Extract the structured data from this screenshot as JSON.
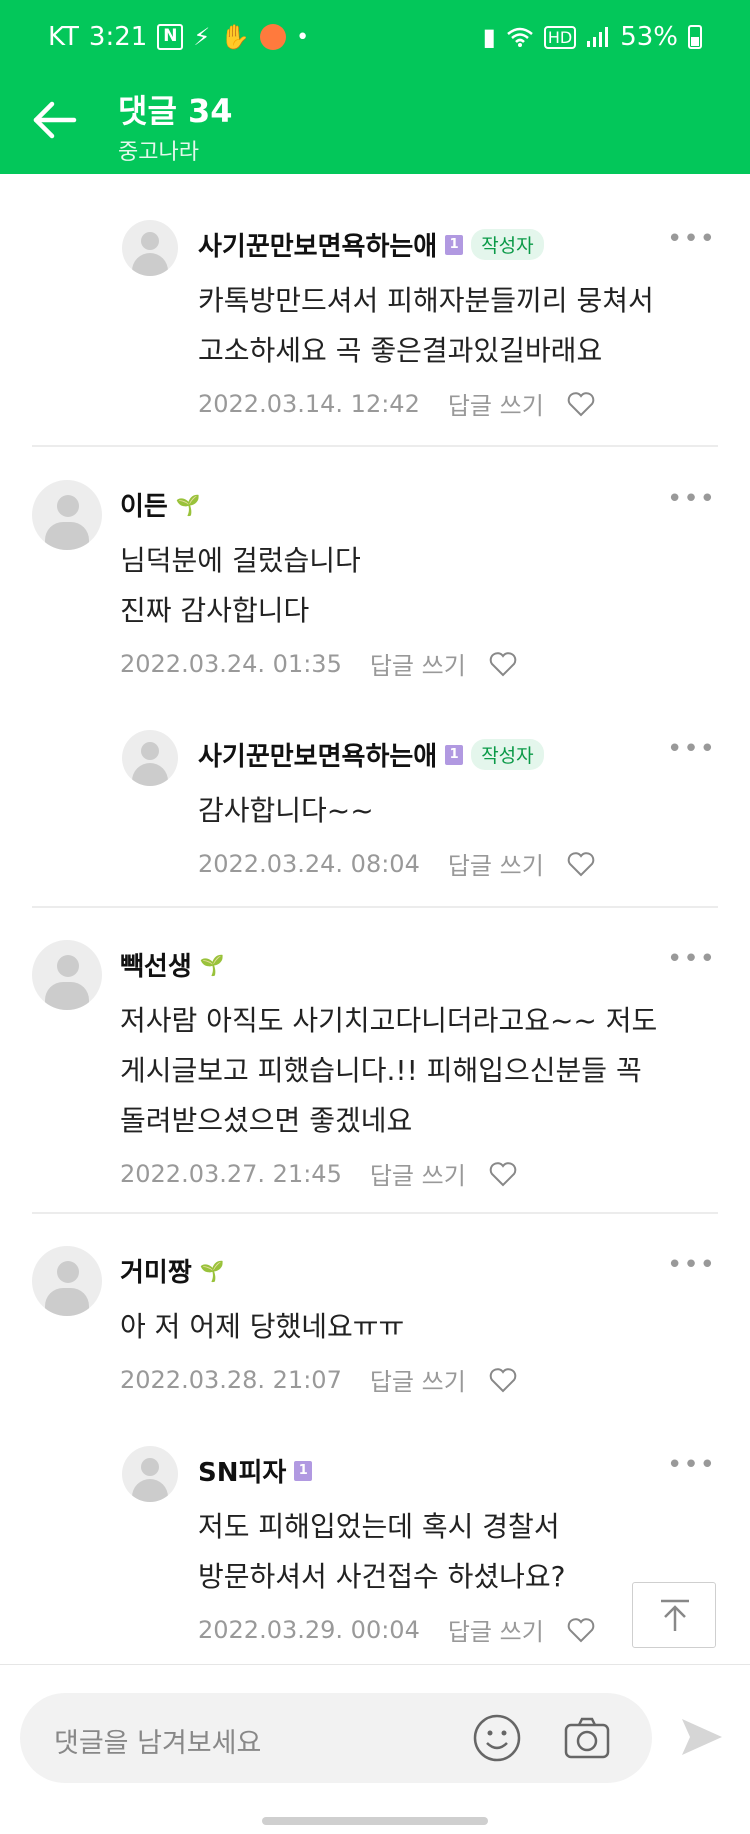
{
  "status": {
    "carrier": "KT",
    "time": "3:21",
    "n_badge": "N",
    "net": "HD",
    "battery": "53%"
  },
  "header": {
    "title": "댓글 34",
    "subtitle": "중고나라"
  },
  "comments": [
    {
      "nick": "사기꾼만보면욕하는애",
      "level": "1",
      "author_badge": "작성자",
      "body": [
        "카톡방만드셔서 피해자분들끼리 뭉쳐서",
        "고소하세요 곡 좋은결과있길바래요"
      ],
      "date": "2022.03.14. 12:42",
      "reply": "답글 쓰기"
    },
    {
      "nick": "이든",
      "body": [
        "님덕분에 걸렀습니다",
        "진짜 감사합니다"
      ],
      "date": "2022.03.24. 01:35",
      "reply": "답글 쓰기"
    },
    {
      "nick": "사기꾼만보면욕하는애",
      "level": "1",
      "author_badge": "작성자",
      "body": [
        "감사합니다~~"
      ],
      "date": "2022.03.24. 08:04",
      "reply": "답글 쓰기"
    },
    {
      "nick": "빽선생",
      "body": [
        "저사람 아직도 사기치고다니더라고요~~ 저도",
        "게시글보고 피했습니다.!! 피해입으신분들 꼭",
        "돌려받으셨으면 좋겠네요"
      ],
      "date": "2022.03.27. 21:45",
      "reply": "답글 쓰기"
    },
    {
      "nick": "거미짱",
      "body": [
        "아 저 어제 당했네요ㅠㅠ"
      ],
      "date": "2022.03.28. 21:07",
      "reply": "답글 쓰기"
    },
    {
      "nick": "SN피자",
      "level": "1",
      "body": [
        "저도 피해입었는데 혹시 경찰서",
        "방문하셔서 사건접수 하셨나요?"
      ],
      "date": "2022.03.29. 00:04",
      "reply": "답글 쓰기"
    }
  ],
  "more_glyph": "•••",
  "input": {
    "placeholder": "댓글을 남겨보세요"
  }
}
